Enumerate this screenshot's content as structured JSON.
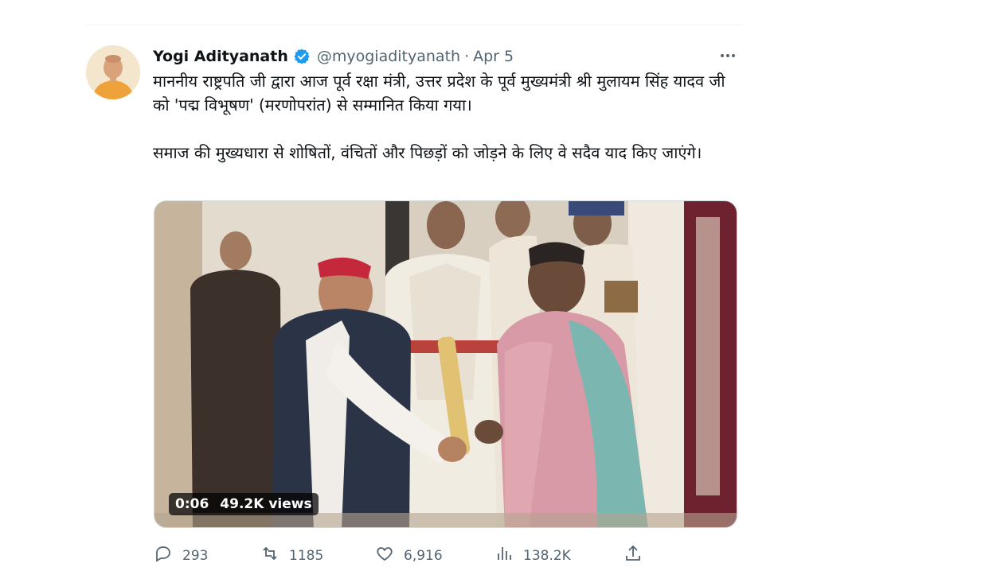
{
  "tweet": {
    "author_name": "Yogi Adityanath",
    "handle": "@myogiadityanath",
    "separator": "·",
    "date": "Apr 5",
    "verified": true,
    "paragraph_1": "माननीय राष्ट्रपति जी द्वारा आज पूर्व रक्षा मंत्री, उत्तर प्रदेश के पूर्व मुख्यमंत्री श्री मुलायम सिंह यादव जी को 'पद्म विभूषण' (मरणोपरांत) से सम्मानित किया गया।",
    "paragraph_2": "समाज की मुख्यधारा से शोषितों, वंचितों और पिछड़ों को जोड़ने के लिए वे सदैव याद किए जाएंगे।",
    "video": {
      "duration": "0:06",
      "views": "49.2K views"
    },
    "actions": {
      "replies": "293",
      "retweets": "1185",
      "likes": "6,916",
      "views": "138.2K"
    }
  },
  "colors": {
    "text": "#0f1419",
    "secondary": "#536471",
    "verified": "#1d9bf0",
    "border": "#cfd9de"
  },
  "icons": [
    "verified-badge-icon",
    "more-icon",
    "reply-icon",
    "retweet-icon",
    "like-icon",
    "views-icon",
    "share-icon"
  ]
}
